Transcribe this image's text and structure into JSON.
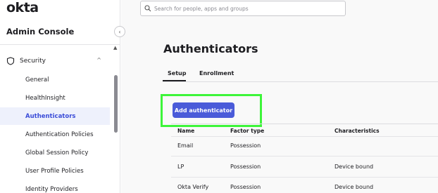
{
  "brand": {
    "logo": "okta",
    "console_title": "Admin Console"
  },
  "sidebar": {
    "section": {
      "label": "Security",
      "expanded": true
    },
    "items": [
      {
        "label": "General",
        "active": false
      },
      {
        "label": "HealthInsight",
        "active": false
      },
      {
        "label": "Authenticators",
        "active": true
      },
      {
        "label": "Authentication Policies",
        "active": false
      },
      {
        "label": "Global Session Policy",
        "active": false
      },
      {
        "label": "User Profile Policies",
        "active": false
      },
      {
        "label": "Identity Providers",
        "active": false
      }
    ]
  },
  "search": {
    "placeholder": "Search for people, apps and groups"
  },
  "page": {
    "title": "Authenticators",
    "tabs": [
      {
        "label": "Setup",
        "active": true
      },
      {
        "label": "Enrollment",
        "active": false
      }
    ],
    "add_button": "Add authenticator"
  },
  "table": {
    "columns": [
      "Name",
      "Factor type",
      "Characteristics"
    ],
    "rows": [
      {
        "name": "Email",
        "factor_type": "Possession",
        "characteristics": ""
      },
      {
        "name": "LP",
        "factor_type": "Possession",
        "characteristics": "Device bound"
      },
      {
        "name": "Okta Verify",
        "factor_type": "Possession",
        "characteristics": "Device bound"
      }
    ]
  },
  "colors": {
    "accent": "#4a5bd9",
    "active_nav_bg": "#eef1fc",
    "highlight": "#3df53a"
  }
}
